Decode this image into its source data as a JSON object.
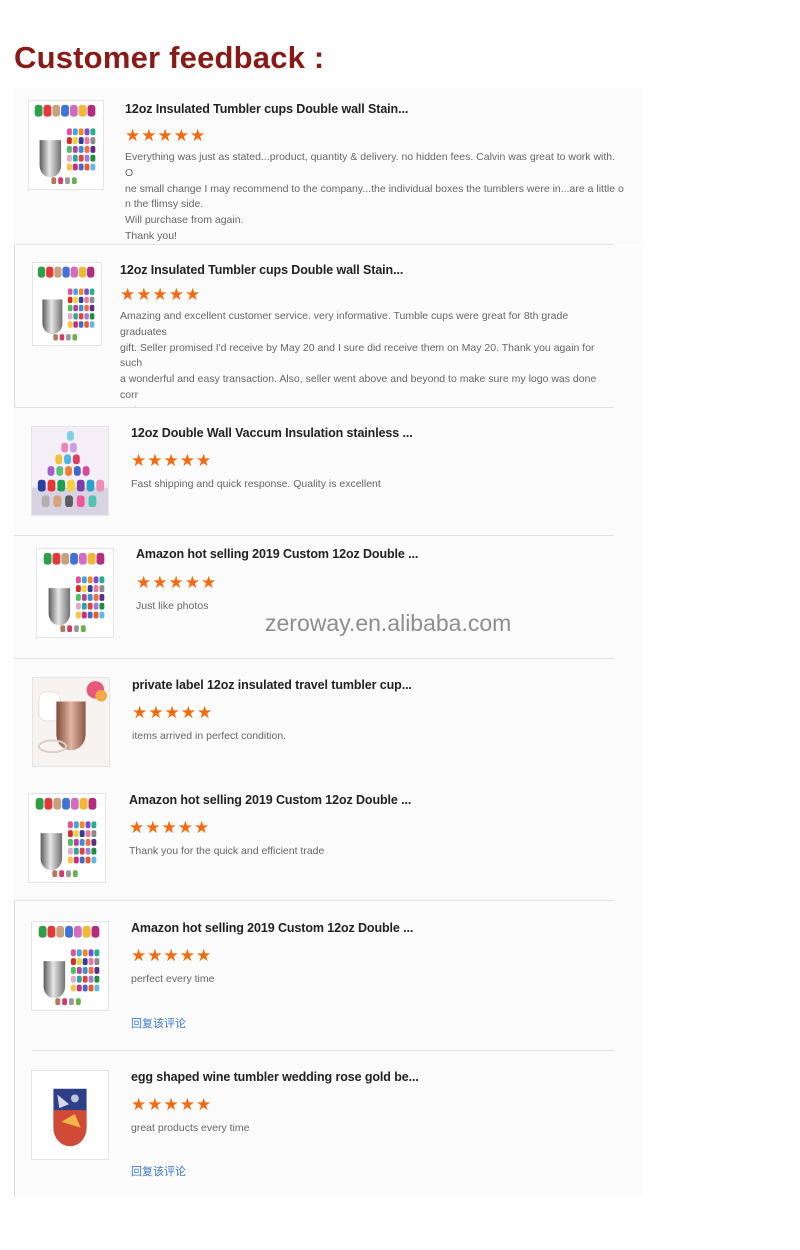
{
  "header": {
    "title": "Customer feedback :"
  },
  "watermark": "zeroway.en.alibaba.com",
  "star_color": "#f26b10",
  "reviews": [
    {
      "title": "12oz Insulated Tumbler cups Double wall Stain...",
      "rating": 5,
      "stars": "★★★★★",
      "comment_lines": [
        "Everything was just as stated...product, quantity & delivery. no hidden fees. Calvin was great to work with. O",
        "ne small change I may recommend to the company...the individual boxes the tumblers were in...are a little o",
        "n the flimsy side.",
        "Will purchase from again.",
        "Thank you!"
      ],
      "thumb_icon": "tumbler-color-grid-icon"
    },
    {
      "title": "12oz Insulated Tumbler cups Double wall Stain...",
      "rating": 5,
      "stars": "★★★★★",
      "comment_lines": [
        "Amazing and excellent customer service. very informative. Tumble cups were great for 8th grade graduates",
        "gift. Seller promised I'd receive by May 20 and I sure did receive them on May 20. Thank you again for such",
        "a wonderful and easy transaction. Also, seller went above and beyond to make sure my logo was done corr",
        "ectly"
      ],
      "thumb_icon": "tumbler-color-grid-icon"
    },
    {
      "title": "12oz Double Wall Vaccum Insulation stainless ...",
      "rating": 5,
      "stars": "★★★★★",
      "comment_lines": [
        "Fast shipping and quick response.  Quality is excellent"
      ],
      "thumb_icon": "tumbler-stack-icon"
    },
    {
      "title": "Amazon hot selling 2019 Custom 12oz Double ...",
      "rating": 5,
      "stars": "★★★★★",
      "comment_lines": [
        "Just like photos"
      ],
      "thumb_icon": "tumbler-color-grid-icon"
    },
    {
      "title": "private label 12oz insulated travel tumbler cup...",
      "rating": 5,
      "stars": "★★★★★",
      "comment_lines": [
        "items arrived in perfect condition."
      ],
      "thumb_icon": "tumbler-rose-gold-icon"
    },
    {
      "title": "Amazon hot selling 2019 Custom 12oz Double ...",
      "rating": 5,
      "stars": "★★★★★",
      "comment_lines": [
        "Thank you for the quick and efficient trade"
      ],
      "thumb_icon": "tumbler-color-grid-icon"
    },
    {
      "title": "Amazon hot selling 2019 Custom 12oz Double ...",
      "rating": 5,
      "stars": "★★★★★",
      "comment_lines": [
        "perfect every time"
      ],
      "reply": "回复该评论",
      "thumb_icon": "tumbler-color-grid-icon"
    },
    {
      "title": "egg shaped wine tumbler wedding rose gold be...",
      "rating": 5,
      "stars": "★★★★★",
      "comment_lines": [
        "great products every time"
      ],
      "reply": "回复该评论",
      "thumb_icon": "tumbler-flag-print-icon"
    }
  ]
}
